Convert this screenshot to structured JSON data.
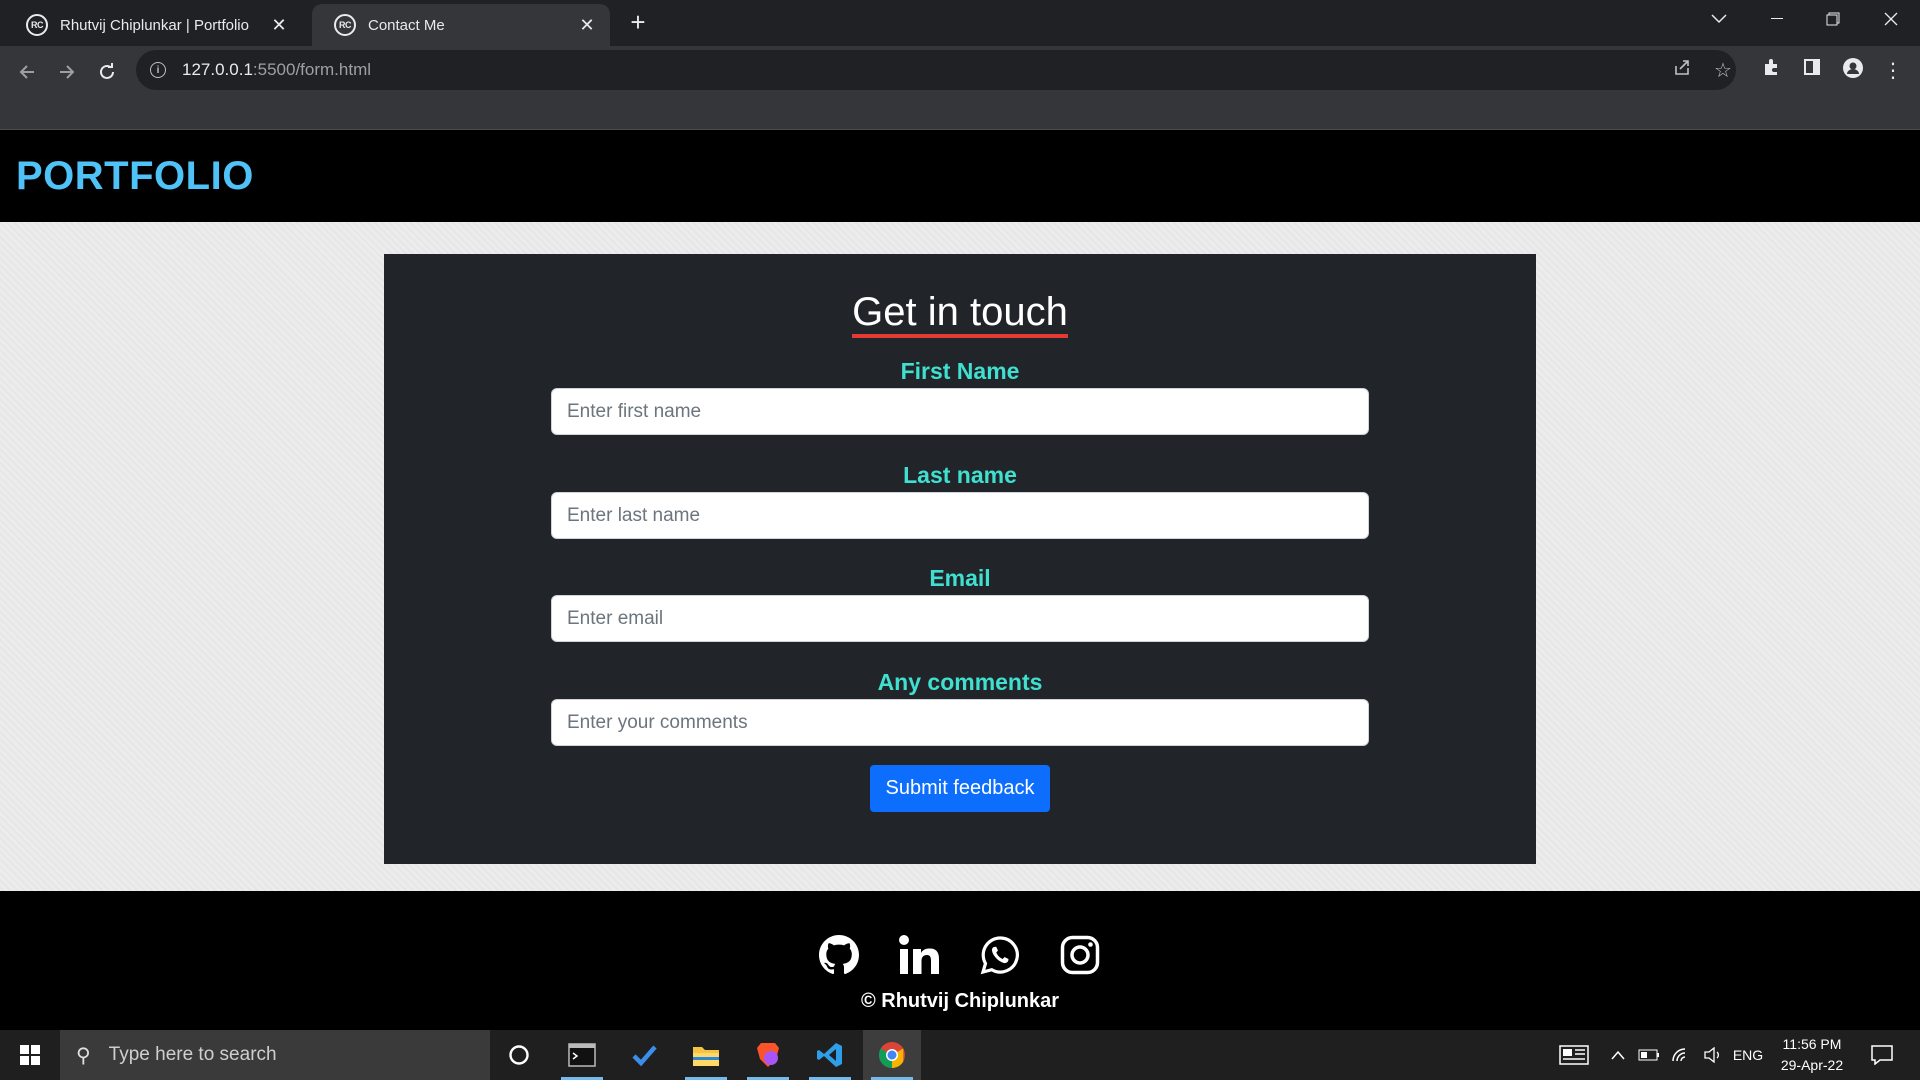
{
  "browser": {
    "tabs": [
      {
        "title": "Rhutvij Chiplunkar | Portfolio",
        "favicon": "RC"
      },
      {
        "title": "Contact Me",
        "favicon": "RC"
      }
    ],
    "url_host": "127.0.0.1",
    "url_path": ":5500/form.html"
  },
  "site": {
    "brand": "PORTFOLIO"
  },
  "form": {
    "heading": "Get in touch",
    "fields": [
      {
        "label": "First Name",
        "placeholder": "Enter first name"
      },
      {
        "label": "Last name",
        "placeholder": "Enter last name"
      },
      {
        "label": "Email",
        "placeholder": "Enter email"
      },
      {
        "label": "Any comments",
        "placeholder": "Enter your comments"
      }
    ],
    "submit_label": "Submit feedback"
  },
  "footer": {
    "social_icons": [
      "github-icon",
      "linkedin-icon",
      "whatsapp-icon",
      "instagram-icon"
    ],
    "copyright": "© Rhutvij Chiplunkar"
  },
  "taskbar": {
    "search_placeholder": "Type here to search",
    "language": "ENG",
    "time": "11:56 PM",
    "date": "29-Apr-22"
  },
  "colors": {
    "brand": "#4fc3f7",
    "label": "#40e0d0",
    "heading_underline": "#e53935",
    "button": "#0d6efd"
  }
}
